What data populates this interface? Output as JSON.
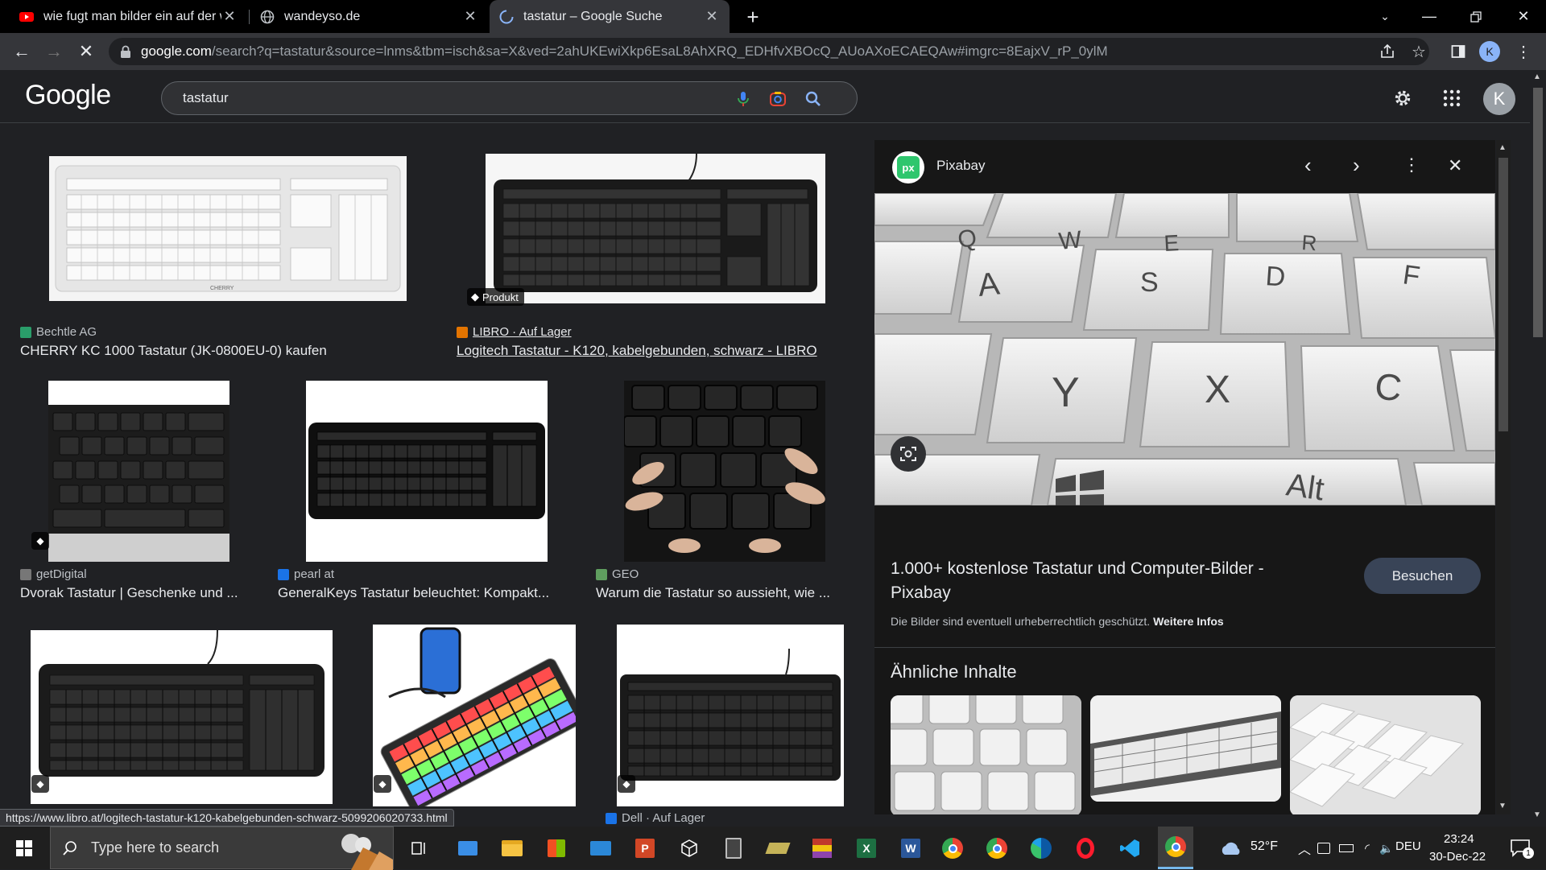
{
  "browser": {
    "tabs": [
      {
        "title": "wie fugt man bilder ein auf der w",
        "favicon": "youtube-icon",
        "active": false
      },
      {
        "title": "wandeyso.de",
        "favicon": "globe-icon",
        "active": false
      },
      {
        "title": "tastatur – Google Suche",
        "favicon": "loading-icon",
        "active": true
      }
    ],
    "url_host": "google.com",
    "url_rest": "/search?q=tastatur&source=lnms&tbm=isch&sa=X&ved=2ahUKEwiXkp6EsaL8AhXRQ_EDHfvXBOcQ_AUoAXoECAEQAw#imgrc=8EajxV_rP_0ylM",
    "profile_letter": "K"
  },
  "google": {
    "logo": "Google",
    "query": "tastatur",
    "account_letter": "K"
  },
  "results": [
    {
      "source": "Bechtle AG",
      "title": "CHERRY KC 1000 Tastatur (JK-0800EU-0) kaufen"
    },
    {
      "source": "LIBRO · Auf Lager",
      "title": "Logitech Tastatur - K120, kabelgebunden, schwarz - LIBRO",
      "badge": "Produkt"
    },
    {
      "source": "getDigital",
      "title": "Dvorak Tastatur | Geschenke und ..."
    },
    {
      "source": "pearl at",
      "title": "GeneralKeys Tastatur beleuchtet: Kompakt..."
    },
    {
      "source": "GEO",
      "title": "Warum die Tastatur so aussieht, wie ..."
    },
    {
      "source": "Dell · Auf Lager",
      "title": ""
    }
  ],
  "preview": {
    "site": "Pixabay",
    "title": "1.000+ kostenlose Tastatur und Computer-Bilder - Pixabay",
    "visit_label": "Besuchen",
    "copyright": "Die Bilder sind eventuell urheberrechtlich geschützt.",
    "more_info": "Weitere Infos",
    "similar_heading": "Ähnliche Inhalte",
    "key_labels": [
      "Q",
      "W",
      "E",
      "R",
      "A",
      "S",
      "D",
      "F",
      "Y",
      "X",
      "C",
      "Alt"
    ]
  },
  "status_url": "https://www.libro.at/logitech-tastatur-k120-kabelgebunden-schwarz-5099206020733.html",
  "taskbar": {
    "search_placeholder": "Type here to search",
    "weather": "52°F",
    "language": "DEU",
    "time": "23:24",
    "date": "30-Dec-22",
    "notification_count": "1"
  },
  "colors": {
    "background": "#202124",
    "panel": "#171717",
    "accent_button": "#394457",
    "link_underline": "#e8eaed"
  }
}
